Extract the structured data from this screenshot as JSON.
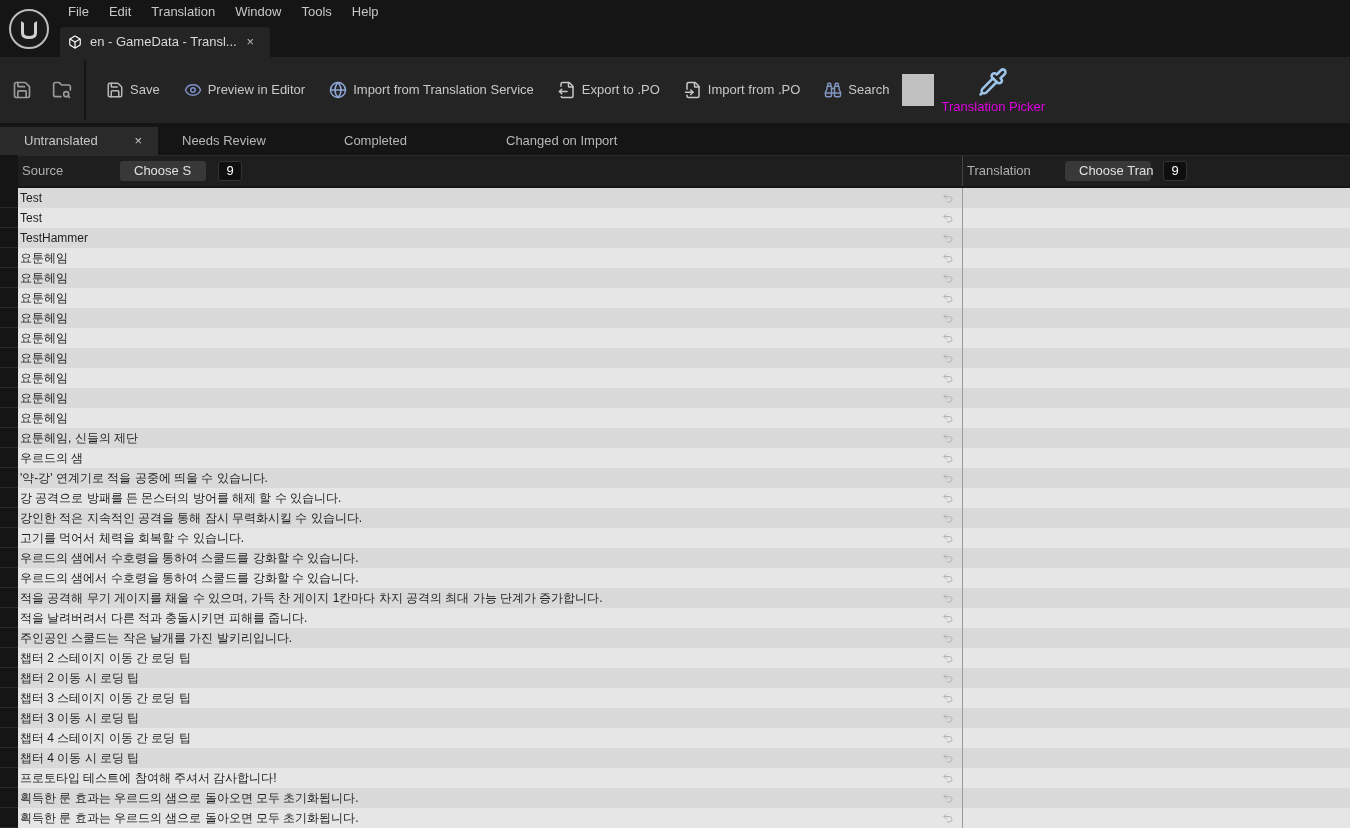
{
  "menu": [
    "File",
    "Edit",
    "Translation",
    "Window",
    "Tools",
    "Help"
  ],
  "document_tab": {
    "title": "en - GameData - Transl...",
    "close": "×"
  },
  "toolbar": {
    "items": [
      {
        "kind": "save",
        "label": "Save"
      },
      {
        "kind": "preview",
        "label": "Preview in Editor"
      },
      {
        "kind": "service",
        "label": "Import from Translation Service"
      },
      {
        "kind": "export",
        "label": "Export to .PO"
      },
      {
        "kind": "import",
        "label": "Import from .PO"
      },
      {
        "kind": "search",
        "label": "Search"
      }
    ],
    "picker": {
      "label": "Translation Picker"
    }
  },
  "tabs": [
    {
      "label": "Untranslated",
      "selected": true,
      "close": "×"
    },
    {
      "label": "Needs Review",
      "selected": false
    },
    {
      "label": "Completed",
      "selected": false
    },
    {
      "label": "Changed on Import",
      "selected": false
    }
  ],
  "columns": [
    {
      "label": "Source",
      "button": "Choose S",
      "font_size": "9"
    },
    {
      "label": "Translation",
      "button": "Choose Tran",
      "font_size": "9"
    }
  ],
  "rows": [
    {
      "source": "Test"
    },
    {
      "source": "Test"
    },
    {
      "source": "TestHammer"
    },
    {
      "source": "요툰헤임"
    },
    {
      "source": "요툰헤임"
    },
    {
      "source": "요툰헤임"
    },
    {
      "source": "요툰헤임"
    },
    {
      "source": "요툰헤임"
    },
    {
      "source": "요툰헤임"
    },
    {
      "source": "요툰헤임"
    },
    {
      "source": "요툰헤임"
    },
    {
      "source": "요툰헤임"
    },
    {
      "source": "요툰헤임, 신들의 제단"
    },
    {
      "source": "우르드의 샘"
    },
    {
      "source": "'약-강' 연계기로 적을 공중에 띄울 수 있습니다."
    },
    {
      "source": "강 공격으로 방패를 든 몬스터의 방어를 해제 할 수 있습니다."
    },
    {
      "source": "강인한 적은 지속적인 공격을 통해 잠시 무력화시킬 수 있습니다."
    },
    {
      "source": "고기를 먹어서 체력을 회복할 수 있습니다."
    },
    {
      "source": "우르드의 샘에서 수호령을 통하여 스쿨드를 강화할 수 있습니다."
    },
    {
      "source": "우르드의 샘에서 수호령을 통하여 스쿨드를 강화할 수 있습니다."
    },
    {
      "source": "적을 공격해 무기 게이지를 채울 수 있으며, 가득 찬 게이지 1칸마다 차지 공격의 최대 가능 단계가 증가합니다."
    },
    {
      "source": "적을 날려버려서 다른 적과 충돌시키면 피해를 줍니다."
    },
    {
      "source": "주인공인 스쿨드는 작은 날개를 가진 발키리입니다."
    },
    {
      "source": "챕터 2 스테이지 이동 간 로딩 팁"
    },
    {
      "source": "챕터 2 이동 시 로딩 팁"
    },
    {
      "source": "챕터 3 스테이지 이동 간 로딩 팁"
    },
    {
      "source": "챕터 3 이동 시 로딩 팁"
    },
    {
      "source": "챕터 4 스테이지 이동 간 로딩 팁"
    },
    {
      "source": "챕터 4 이동 시 로딩 팁"
    },
    {
      "source": "프로토타입 테스트에 참여해 주셔서 감사합니다!"
    },
    {
      "source": "획득한 룬 효과는 우르드의 샘으로 돌아오면 모두 초기화됩니다."
    },
    {
      "source": "획득한 룬 효과는 우르드의 샘으로 돌아오면 모두 초기화됩니다."
    }
  ]
}
